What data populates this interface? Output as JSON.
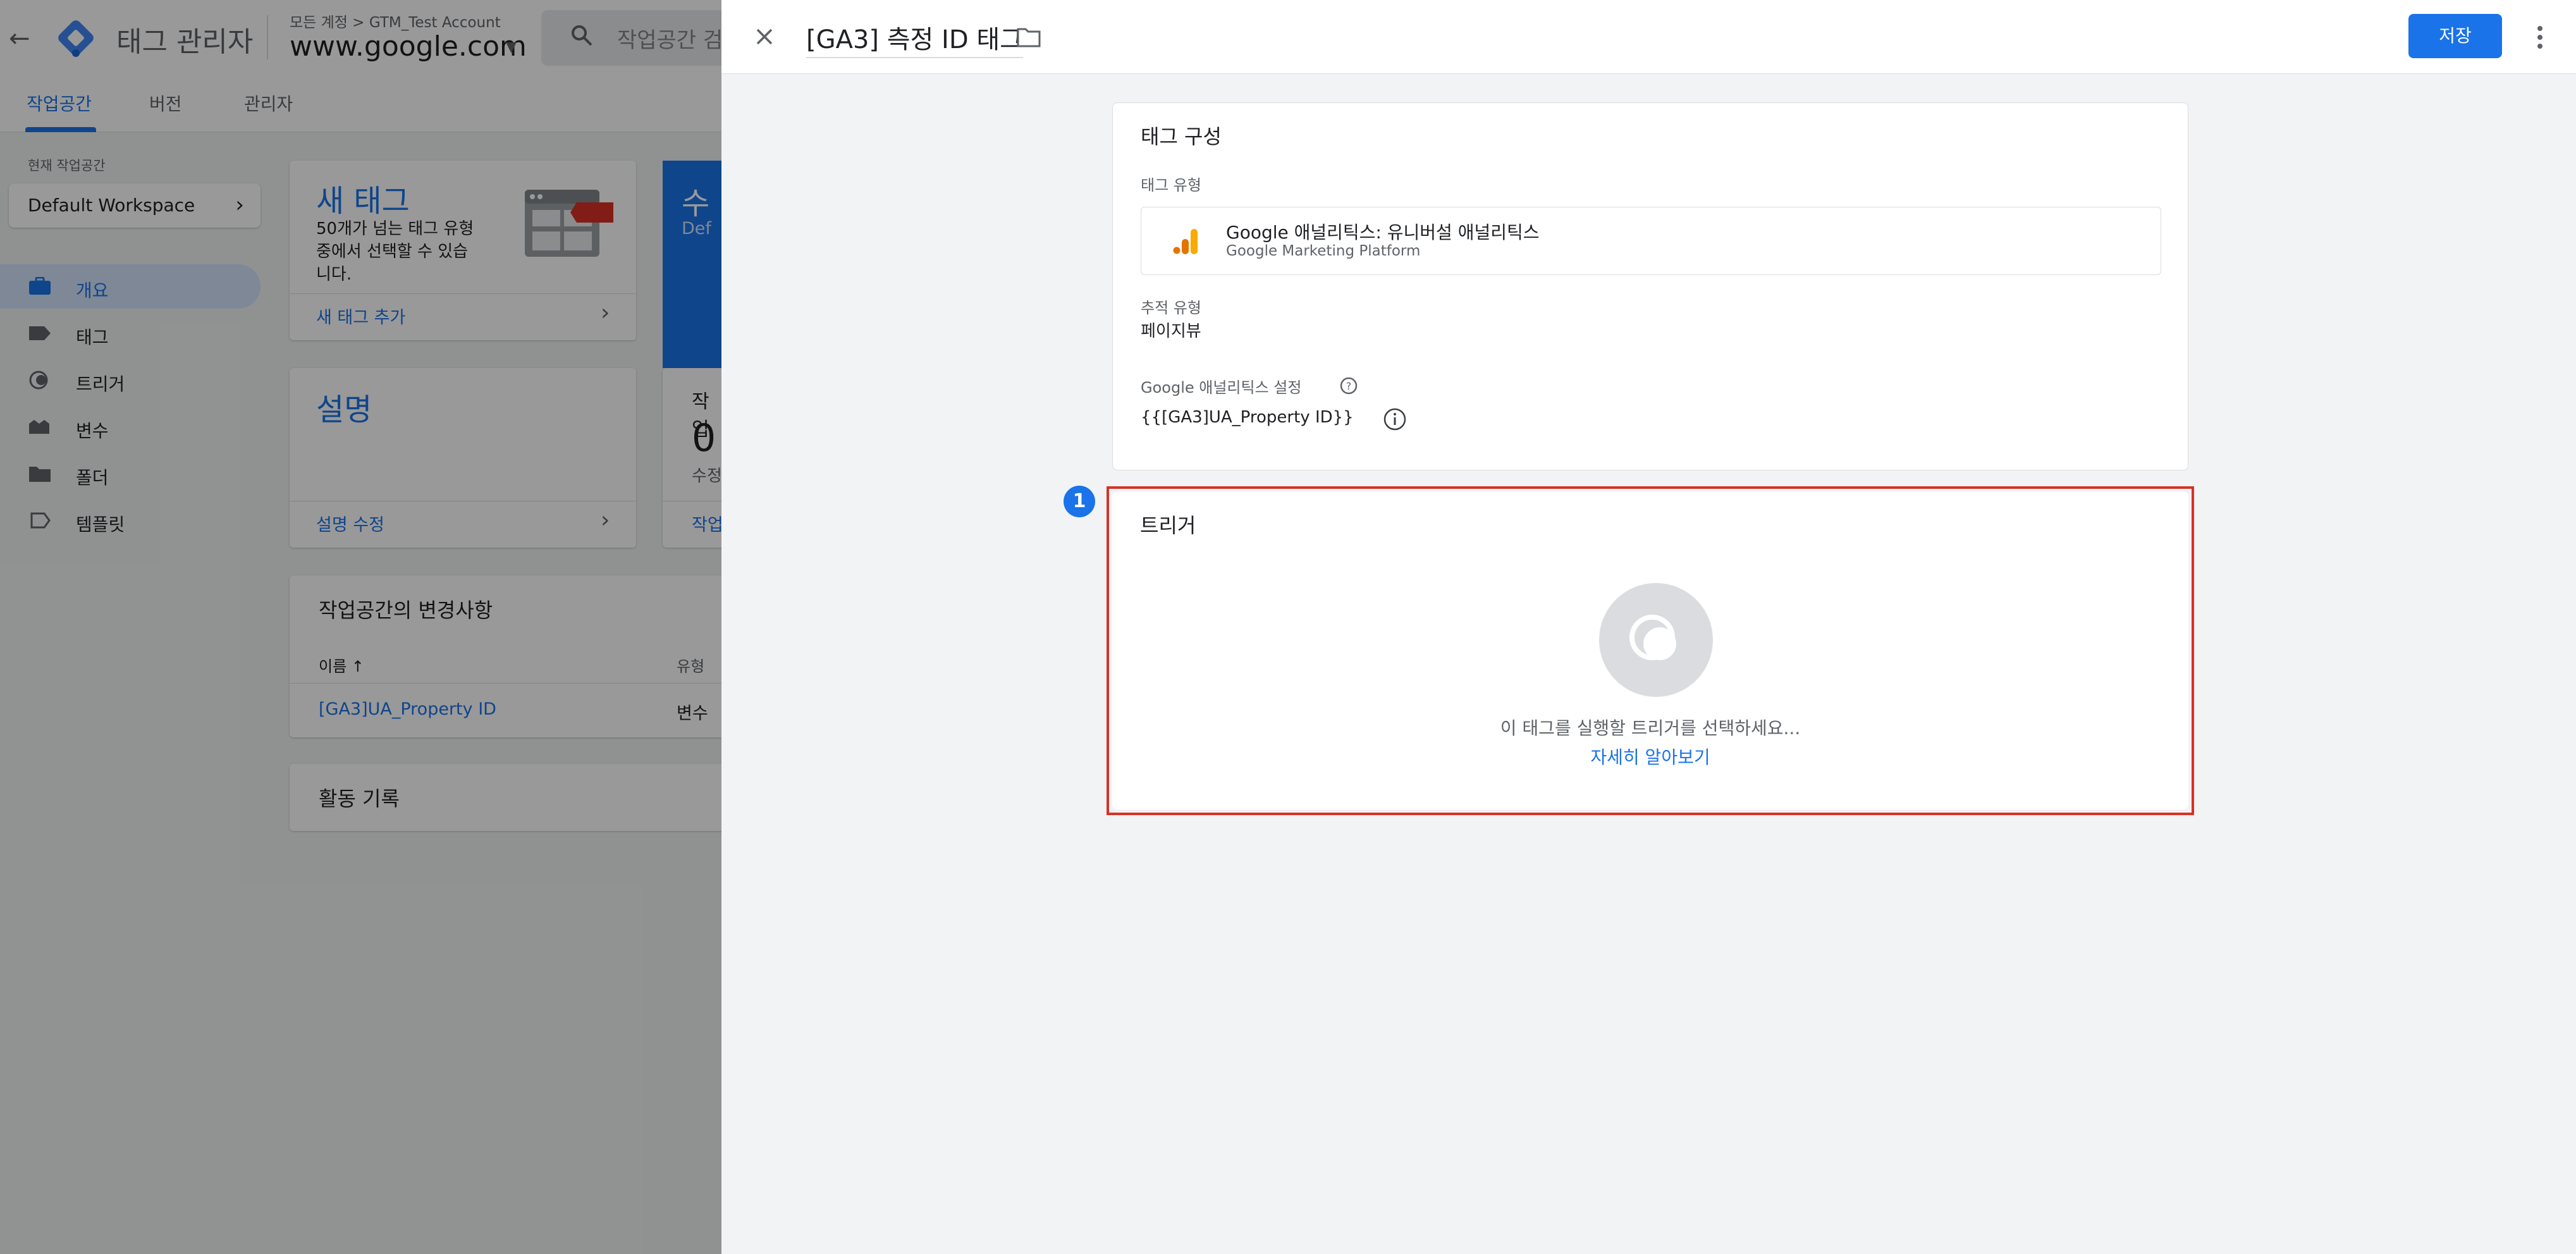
{
  "app": {
    "title": "태그 관리자",
    "account_path": "모든 계정 > GTM_Test Account",
    "container_name": "www.google.com",
    "search_placeholder": "작업공간 검색"
  },
  "tabs": [
    {
      "label": "작업공간",
      "active": true
    },
    {
      "label": "버전",
      "active": false
    },
    {
      "label": "관리자",
      "active": false
    }
  ],
  "sidebar": {
    "workspace_label": "현재 작업공간",
    "workspace_name": "Default Workspace",
    "items": [
      {
        "label": "개요",
        "icon": "briefcase-icon",
        "active": true
      },
      {
        "label": "태그",
        "icon": "tag-icon",
        "active": false
      },
      {
        "label": "트리거",
        "icon": "trigger-icon",
        "active": false
      },
      {
        "label": "변수",
        "icon": "variable-icon",
        "active": false
      },
      {
        "label": "폴더",
        "icon": "folder-icon",
        "active": false
      },
      {
        "label": "템플릿",
        "icon": "template-icon",
        "active": false
      }
    ]
  },
  "overview": {
    "new_tag": {
      "title": "새 태그",
      "desc_lines": [
        "50개가 넘는 태그 유형",
        "중에서 선택할 수 있습",
        "니다."
      ],
      "link": "새 태그 추가"
    },
    "description": {
      "title": "설명",
      "link": "설명 수정"
    },
    "peek": {
      "blue_title": "수",
      "blue_sub": "Def",
      "stat_label": "작업",
      "stat_value": "0",
      "stat_sub": "수정",
      "stat_link": "작업"
    },
    "changes": {
      "title": "작업공간의 변경사항",
      "col_name": "이름 ↑",
      "col_type": "유형",
      "rows": [
        {
          "name": "[GA3]UA_Property ID",
          "type": "변수"
        }
      ]
    },
    "activity": {
      "title": "활동 기록"
    }
  },
  "panel": {
    "title": "[GA3] 측정 ID 태그",
    "save_label": "저장",
    "config": {
      "section_title": "태그 구성",
      "tag_type_label": "태그 유형",
      "tag_type_name": "Google 애널리틱스: 유니버설 애널리틱스",
      "tag_type_sub": "Google Marketing Platform",
      "track_type_label": "추적 유형",
      "track_type_value": "페이지뷰",
      "settings_label": "Google 애널리틱스 설정",
      "settings_value": "{{[GA3]UA_Property ID}}"
    },
    "trigger": {
      "section_title": "트리거",
      "prompt": "이 태그를 실행할 트리거를 선택하세요...",
      "learn_more": "자세히 알아보기"
    },
    "step_badge": "1"
  },
  "colors": {
    "accent": "#1a73e8",
    "highlight": "#d93025",
    "ga_orange": "#f9ab00",
    "ga_dark_orange": "#e37400"
  }
}
